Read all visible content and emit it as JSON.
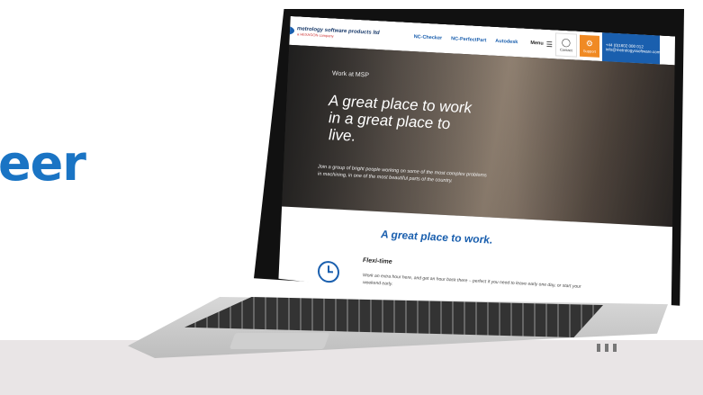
{
  "page": {
    "partial_heading": "eer"
  },
  "site": {
    "brand": "metrology software products ltd",
    "brand_sub": "a HEXAGON company",
    "nav": [
      "NC-Checker",
      "NC-PerfectPart",
      "Autodesk"
    ],
    "menu_label": "Menu",
    "contact_label": "Contact",
    "support_label": "Support",
    "phone": "+44 (0)1602 000 012",
    "email": "info@metrologyssoftware.com"
  },
  "hero": {
    "eyebrow": "Work at MSP",
    "title": "A great place to work in a great place to live.",
    "body": "Join a group of bright people working on some of the most complex problems in machining, in one of the most beautiful parts of the country."
  },
  "section": {
    "title": "A great place to work.",
    "feature_title": "Flexi-time",
    "feature_body": "Work an extra hour here, and get an hour back there – perfect if you need to leave early one day, or start your weekend early."
  },
  "colors": {
    "brand_blue": "#1a74c4",
    "support_orange": "#f08a24"
  }
}
